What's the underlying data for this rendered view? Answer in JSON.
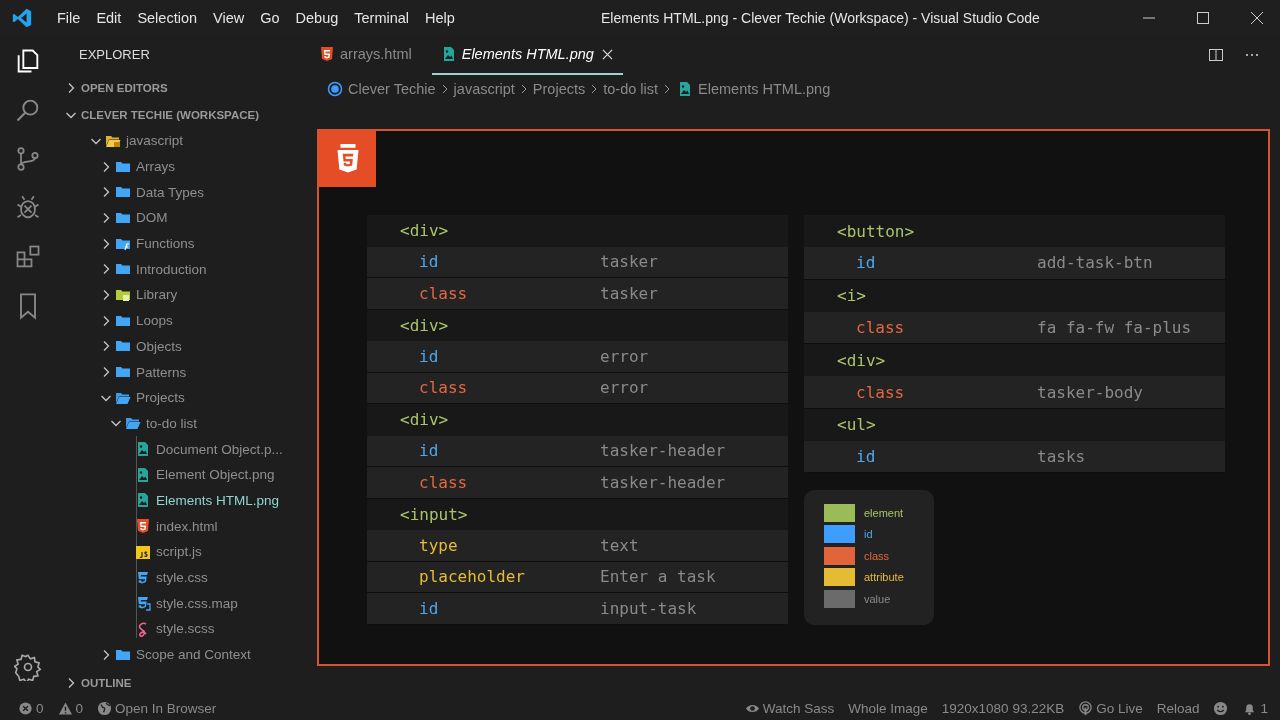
{
  "window": {
    "title": "Elements HTML.png - Clever Techie (Workspace) - Visual Studio Code"
  },
  "menu": [
    "File",
    "Edit",
    "Selection",
    "View",
    "Go",
    "Debug",
    "Terminal",
    "Help"
  ],
  "explorer": {
    "title": "EXPLORER",
    "open_editors": {
      "label": "OPEN EDITORS",
      "expanded": false
    },
    "workspace": {
      "label": "CLEVER TECHIE (WORKSPACE)",
      "expanded": true,
      "children": [
        {
          "label": "javascript",
          "kind": "folder-js",
          "expanded": true,
          "selected": false,
          "children": [
            {
              "label": "Arrays",
              "kind": "folder",
              "expanded": false,
              "selected": false
            },
            {
              "label": "Data Types",
              "kind": "folder",
              "expanded": false,
              "selected": false
            },
            {
              "label": "DOM",
              "kind": "folder",
              "expanded": false,
              "selected": false
            },
            {
              "label": "Functions",
              "kind": "folder-fx",
              "expanded": false,
              "selected": false
            },
            {
              "label": "Introduction",
              "kind": "folder",
              "expanded": false,
              "selected": false
            },
            {
              "label": "Library",
              "kind": "folder-lib",
              "expanded": false,
              "selected": false
            },
            {
              "label": "Loops",
              "kind": "folder",
              "expanded": false,
              "selected": false
            },
            {
              "label": "Objects",
              "kind": "folder",
              "expanded": false,
              "selected": false
            },
            {
              "label": "Patterns",
              "kind": "folder",
              "expanded": false,
              "selected": false
            },
            {
              "label": "Projects",
              "kind": "folder",
              "expanded": true,
              "selected": false,
              "children": [
                {
                  "label": "to-do list",
                  "kind": "folder",
                  "expanded": true,
                  "selected": false,
                  "children": [
                    {
                      "label": "Document Object.p...",
                      "kind": "image",
                      "selected": false
                    },
                    {
                      "label": "Element Object.png",
                      "kind": "image",
                      "selected": false
                    },
                    {
                      "label": "Elements HTML.png",
                      "kind": "image",
                      "selected": true
                    },
                    {
                      "label": "index.html",
                      "kind": "html",
                      "selected": false
                    },
                    {
                      "label": "script.js",
                      "kind": "js",
                      "selected": false
                    },
                    {
                      "label": "style.css",
                      "kind": "css",
                      "selected": false
                    },
                    {
                      "label": "style.css.map",
                      "kind": "cssmap",
                      "selected": false
                    },
                    {
                      "label": "style.scss",
                      "kind": "scss",
                      "selected": false
                    }
                  ]
                }
              ]
            },
            {
              "label": "Scope and Context",
              "kind": "folder",
              "expanded": false,
              "selected": false
            }
          ]
        }
      ]
    },
    "outline": {
      "label": "OUTLINE",
      "expanded": false
    }
  },
  "tabs": [
    {
      "label": "arrays.html",
      "kind": "html",
      "selected": false
    },
    {
      "label": "Elements HTML.png",
      "kind": "image",
      "selected": true
    }
  ],
  "breadcrumbs": [
    {
      "label": "Clever Techie",
      "kind": "workspace"
    },
    {
      "label": "javascript",
      "kind": "folder"
    },
    {
      "label": "Projects",
      "kind": "folder"
    },
    {
      "label": "to-do list",
      "kind": "folder"
    },
    {
      "label": "Elements HTML.png",
      "kind": "image"
    }
  ],
  "diagram": {
    "left_table": [
      {
        "kind": "element",
        "name": "<div>"
      },
      {
        "kind": "id",
        "name": "id",
        "value": "tasker"
      },
      {
        "kind": "class",
        "name": "class",
        "value": "tasker"
      },
      {
        "kind": "element",
        "name": "<div>"
      },
      {
        "kind": "id",
        "name": "id",
        "value": "error"
      },
      {
        "kind": "class",
        "name": "class",
        "value": "error"
      },
      {
        "kind": "element",
        "name": "<div>"
      },
      {
        "kind": "id",
        "name": "id",
        "value": "tasker-header"
      },
      {
        "kind": "class",
        "name": "class",
        "value": "tasker-header"
      },
      {
        "kind": "element",
        "name": "<input>"
      },
      {
        "kind": "attribute",
        "name": "type",
        "value": "text"
      },
      {
        "kind": "attribute",
        "name": "placeholder",
        "value": "Enter a task"
      },
      {
        "kind": "id",
        "name": "id",
        "value": "input-task"
      }
    ],
    "right_table": [
      {
        "kind": "element",
        "name": "<button>"
      },
      {
        "kind": "id",
        "name": "id",
        "value": "add-task-btn"
      },
      {
        "kind": "element",
        "name": "<i>"
      },
      {
        "kind": "class",
        "name": "class",
        "value": "fa fa-fw fa-plus"
      },
      {
        "kind": "element",
        "name": "<div>"
      },
      {
        "kind": "class",
        "name": "class",
        "value": "tasker-body"
      },
      {
        "kind": "element",
        "name": "<ul>"
      },
      {
        "kind": "id",
        "name": "id",
        "value": "tasks"
      }
    ],
    "legend": [
      {
        "kind": "element",
        "label": "element",
        "color": "#9bbb59"
      },
      {
        "kind": "id",
        "label": "id",
        "color": "#3d9eff"
      },
      {
        "kind": "class",
        "label": "class",
        "color": "#e2643a"
      },
      {
        "kind": "attribute",
        "label": "attribute",
        "color": "#e5bb33"
      },
      {
        "kind": "value",
        "label": "value",
        "color": "#6b6b6b"
      }
    ]
  },
  "status_bar": {
    "left": [
      {
        "kind": "errors",
        "text": "0"
      },
      {
        "kind": "warnings",
        "text": "0"
      },
      {
        "kind": "browser",
        "text": "Open In Browser"
      }
    ],
    "right": [
      {
        "kind": "eye",
        "text": "Watch Sass"
      },
      {
        "kind": "plain",
        "text": "Whole Image"
      },
      {
        "kind": "plain",
        "text": "1920x1080 93.22KB"
      },
      {
        "kind": "live",
        "text": "Go Live"
      },
      {
        "kind": "plain",
        "text": "Reload"
      },
      {
        "kind": "smiley"
      },
      {
        "kind": "bell",
        "text": "1"
      }
    ]
  }
}
